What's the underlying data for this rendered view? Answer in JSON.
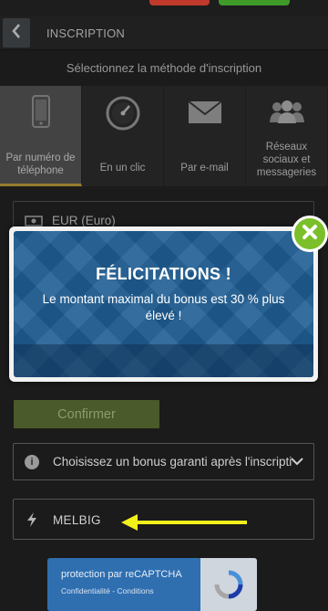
{
  "header": {
    "title": "INSCRIPTION",
    "back_icon": "chevron-left-icon"
  },
  "subtitle": "Sélectionnez la méthode d'inscription",
  "methods": [
    {
      "label": "Par numéro de téléphone",
      "icon": "phone-icon",
      "active": true
    },
    {
      "label": "En un clic",
      "icon": "speedometer-icon",
      "active": false
    },
    {
      "label": "Par e-mail",
      "icon": "envelope-icon",
      "active": false
    },
    {
      "label": "Réseaux sociaux et messageries",
      "icon": "users-icon",
      "active": false
    }
  ],
  "currency": {
    "value": "EUR (Euro)",
    "icon": "banknote-icon"
  },
  "modal": {
    "title": "FÉLICITATIONS !",
    "text": "Le montant maximal du bonus est 30 % plus élevé !",
    "close_icon": "close-icon"
  },
  "confirm_label": "Confirmer",
  "bonus": {
    "value": "Choisissez un bonus garanti après l'inscription",
    "icon": "info-icon"
  },
  "promo": {
    "value": "MELBIG",
    "icon": "lightning-icon"
  },
  "recaptcha": {
    "title": "protection par reCAPTCHA",
    "links": "Confidentialité - Conditions"
  },
  "colors": {
    "background": "#252525",
    "active_accent": "#c8a640",
    "modal_blue": "#1f5e93",
    "close_green": "#7bbf2a",
    "arrow_yellow": "#f2f21a"
  }
}
